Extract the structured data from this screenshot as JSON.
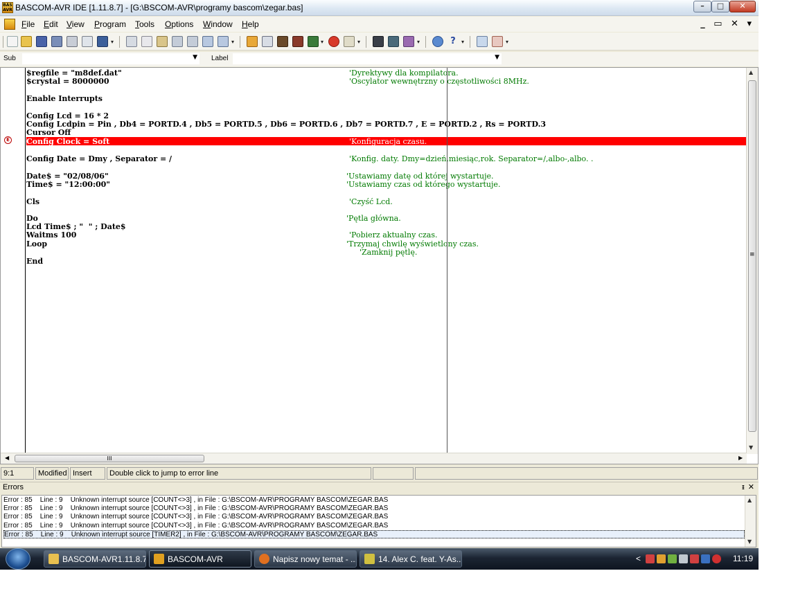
{
  "window": {
    "title": "BASCOM-AVR IDE [1.11.8.7] - [G:\\BSCOM-AVR\\programy bascom\\zegar.bas]",
    "app_icon_text": "BAS AVR"
  },
  "title_buttons": {
    "minimize": "–",
    "maximize": "□",
    "close": "✕"
  },
  "menu": {
    "items": [
      {
        "label": "File",
        "u": "F",
        "rest": "ile"
      },
      {
        "label": "Edit",
        "u": "E",
        "rest": "dit"
      },
      {
        "label": "View",
        "u": "V",
        "rest": "iew"
      },
      {
        "label": "Program",
        "u": "P",
        "rest": "rogram"
      },
      {
        "label": "Tools",
        "u": "T",
        "rest": "ools"
      },
      {
        "label": "Options",
        "u": "O",
        "rest": "ptions"
      },
      {
        "label": "Window",
        "u": "W",
        "rest": "indow"
      },
      {
        "label": "Help",
        "u": "H",
        "rest": "elp"
      }
    ],
    "mdi_controls": "_ ▭ ✕ ▾"
  },
  "subbar": {
    "sub_label": "Sub",
    "label_label": "Label",
    "sub_value": "",
    "label_value": ""
  },
  "editor": {
    "lines": [
      "$regfile = \"m8def.dat\"",
      "$crystal = 8000000",
      "Enable Interrupts",
      "Config Lcd = 16 * 2",
      "Config Lcdpin = Pin , Db4 = PORTD.4 , Db5 = PORTD.5 , Db6 = PORTD.6 , Db7 = PORTD.7 , E = PORTD.2 , Rs = PORTD.3",
      "Cursor Off",
      "Config Clock = Soft",
      "Config Date = Dmy , Separator = /",
      "Date$ = \"02/08/06\"",
      "Time$ = \"12:00:00\"",
      "Cls",
      "Do",
      "Lcd Time$ ; \"  \" ; Date$",
      "Waitms 100",
      "Loop",
      "End"
    ],
    "comments": [
      "'Dyrektywy dla kompilatora.",
      "'Oscylator wewnętrzny o częstotliwości 8MHz.",
      "'Konfiguracja czasu.",
      "'Konfig. daty. Dmy=dzień,miesiąc,rok. Separator=/,albo-,albo. .",
      "'Ustawiamy datę od której wystartuje.",
      "'Ustawiamy czas od którego wystartuje.",
      "'Czyść Lcd.",
      "'Pętla główna.",
      "'Pobierz aktualny czas.",
      "'Trzymaj chwilę wyświetlony czas.",
      "'Zamknij pętlę."
    ],
    "breakpoint_icon": "E",
    "hscroll_grip": "III",
    "vscroll_grip": "≡"
  },
  "status": {
    "position": "9:1",
    "modified": "Modified",
    "mode": "Insert",
    "hint": "Double click to jump to error line"
  },
  "errors": {
    "title": "Errors",
    "pin": "ᵻ",
    "close": "✕",
    "rows": [
      "Error : 85    Line : 9    Unknown interrupt source [COUNT<>3] , in File : G:\\BSCOM-AVR\\PROGRAMY BASCOM\\ZEGAR.BAS",
      "Error : 85    Line : 9    Unknown interrupt source [COUNT<>3] , in File : G:\\BSCOM-AVR\\PROGRAMY BASCOM\\ZEGAR.BAS",
      "Error : 85    Line : 9    Unknown interrupt source [COUNT<>3] , in File : G:\\BSCOM-AVR\\PROGRAMY BASCOM\\ZEGAR.BAS",
      "Error : 85    Line : 9    Unknown interrupt source [COUNT<>3] , in File : G:\\BSCOM-AVR\\PROGRAMY BASCOM\\ZEGAR.BAS",
      "Error : 85    Line : 9    Unknown interrupt source [TIMER2] , in File : G:\\BSCOM-AVR\\PROGRAMY BASCOM\\ZEGAR.BAS"
    ]
  },
  "taskbar": {
    "tasks": [
      {
        "label": "BASCOM-AVR1.11.8.7",
        "icon": "folder-icon",
        "color": "#e8c050"
      },
      {
        "label": "BASCOM-AVR",
        "icon": "bascom-icon",
        "color": "#e0a020"
      },
      {
        "label": "Napisz nowy temat - ...",
        "icon": "firefox-icon",
        "color": "#e07020"
      },
      {
        "label": "14. Alex C. feat. Y-As...",
        "icon": "media-icon",
        "color": "#d0c040"
      }
    ],
    "tray_chevron": "<",
    "clock": "11:19"
  },
  "colors": {
    "highlight": "#ff0000",
    "keyword": "#000000",
    "operator": "#d40000",
    "comment": "#007a00"
  }
}
